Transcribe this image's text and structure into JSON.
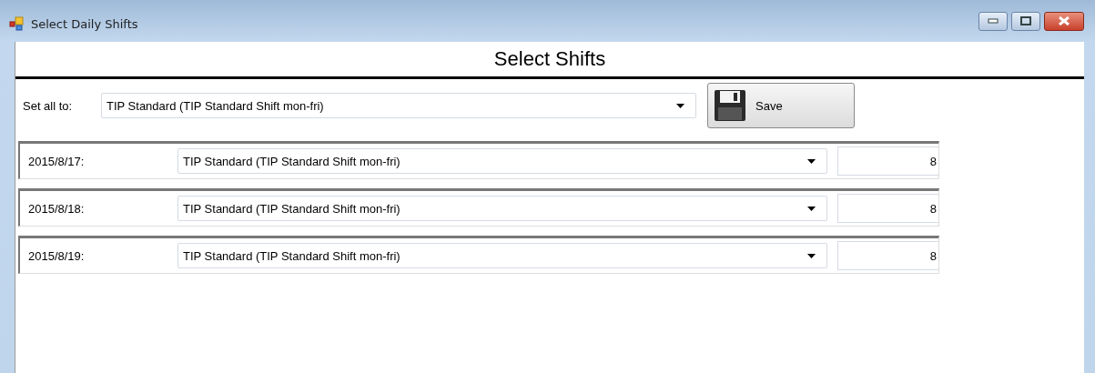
{
  "window": {
    "title": "Select Daily Shifts"
  },
  "header": {
    "title": "Select Shifts"
  },
  "set_all": {
    "label": "Set all to:",
    "value": "TIP Standard (TIP Standard Shift mon-fri)"
  },
  "save_button": {
    "label": "Save"
  },
  "days": [
    {
      "date": "2015/8/17:",
      "shift": "TIP Standard (TIP Standard Shift mon-fri)",
      "hours": "8"
    },
    {
      "date": "2015/8/18:",
      "shift": "TIP Standard (TIP Standard Shift mon-fri)",
      "hours": "8"
    },
    {
      "date": "2015/8/19:",
      "shift": "TIP Standard (TIP Standard Shift mon-fri)",
      "hours": "8"
    }
  ]
}
